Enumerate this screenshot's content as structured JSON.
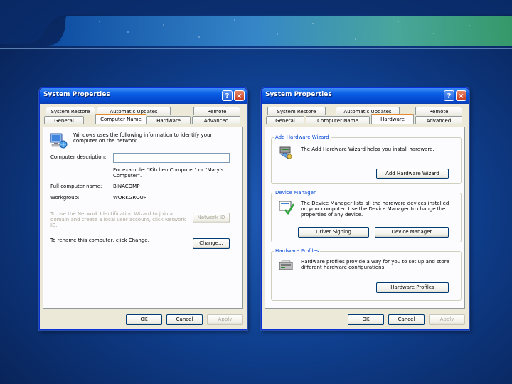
{
  "left_window": {
    "title": "System Properties",
    "tabs_row1": [
      "System Restore",
      "Automatic Updates",
      "Remote"
    ],
    "tabs_row2": [
      "General",
      "Computer Name",
      "Hardware",
      "Advanced"
    ],
    "intro": "Windows uses the following information to identify your computer on the network.",
    "computer_description_label": "Computer description:",
    "computer_description_value": "",
    "example_text": "For example: \"Kitchen Computer\" or \"Mary's Computer\".",
    "full_name_label": "Full computer name:",
    "full_name_value": "BINACOMP",
    "workgroup_label": "Workgroup:",
    "workgroup_value": "WORKGROUP",
    "network_id_text": "To use the Network Identification Wizard to join a domain and create a local user account, click Network ID.",
    "network_id_button": "Network ID",
    "rename_text": "To rename this computer, click Change.",
    "change_button": "Change...",
    "ok": "OK",
    "cancel": "Cancel",
    "apply": "Apply"
  },
  "right_window": {
    "title": "System Properties",
    "tabs_row1": [
      "System Restore",
      "Automatic Updates",
      "Remote"
    ],
    "tabs_row2": [
      "General",
      "Computer Name",
      "Hardware",
      "Advanced"
    ],
    "wizard_group_title": "Add Hardware Wizard",
    "wizard_text": "The Add Hardware Wizard helps you install hardware.",
    "wizard_button": "Add Hardware Wizard",
    "device_group_title": "Device Manager",
    "device_text": "The Device Manager lists all the hardware devices installed on your computer. Use the Device Manager to change the properties of any device.",
    "driver_signing_button": "Driver Signing",
    "device_manager_button": "Device Manager",
    "profiles_group_title": "Hardware Profiles",
    "profiles_text": "Hardware profiles provide a way for you to set up and store different hardware configurations.",
    "profiles_button": "Hardware Profiles",
    "ok": "OK",
    "cancel": "Cancel",
    "apply": "Apply"
  },
  "titlebar_buttons": {
    "help": "?",
    "close": "×"
  },
  "colors": {
    "title_blue": "#0447cc",
    "active_tab_accent": "#e68b2c",
    "dialog_face": "#ece9d8",
    "group_title": "#0046d5"
  }
}
